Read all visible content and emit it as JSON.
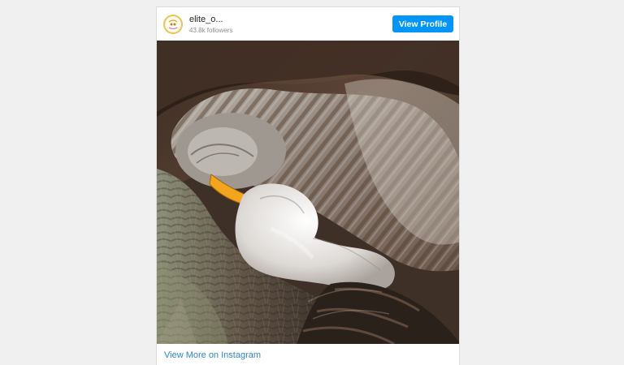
{
  "embed": {
    "account": {
      "username": "elite_o...",
      "followers": "43.8k followers",
      "avatar_icon": "owl-logo-icon"
    },
    "buttons": {
      "view_profile": "View Profile"
    },
    "post": {
      "image_alt": "Owl sleeping over a fluffy owlet in a tree hollow",
      "view_more": "View More on Instagram"
    },
    "colors": {
      "background": "#f0f0f0",
      "card": "#ffffff",
      "button": "#0095f6",
      "link": "#2d87c9"
    }
  }
}
